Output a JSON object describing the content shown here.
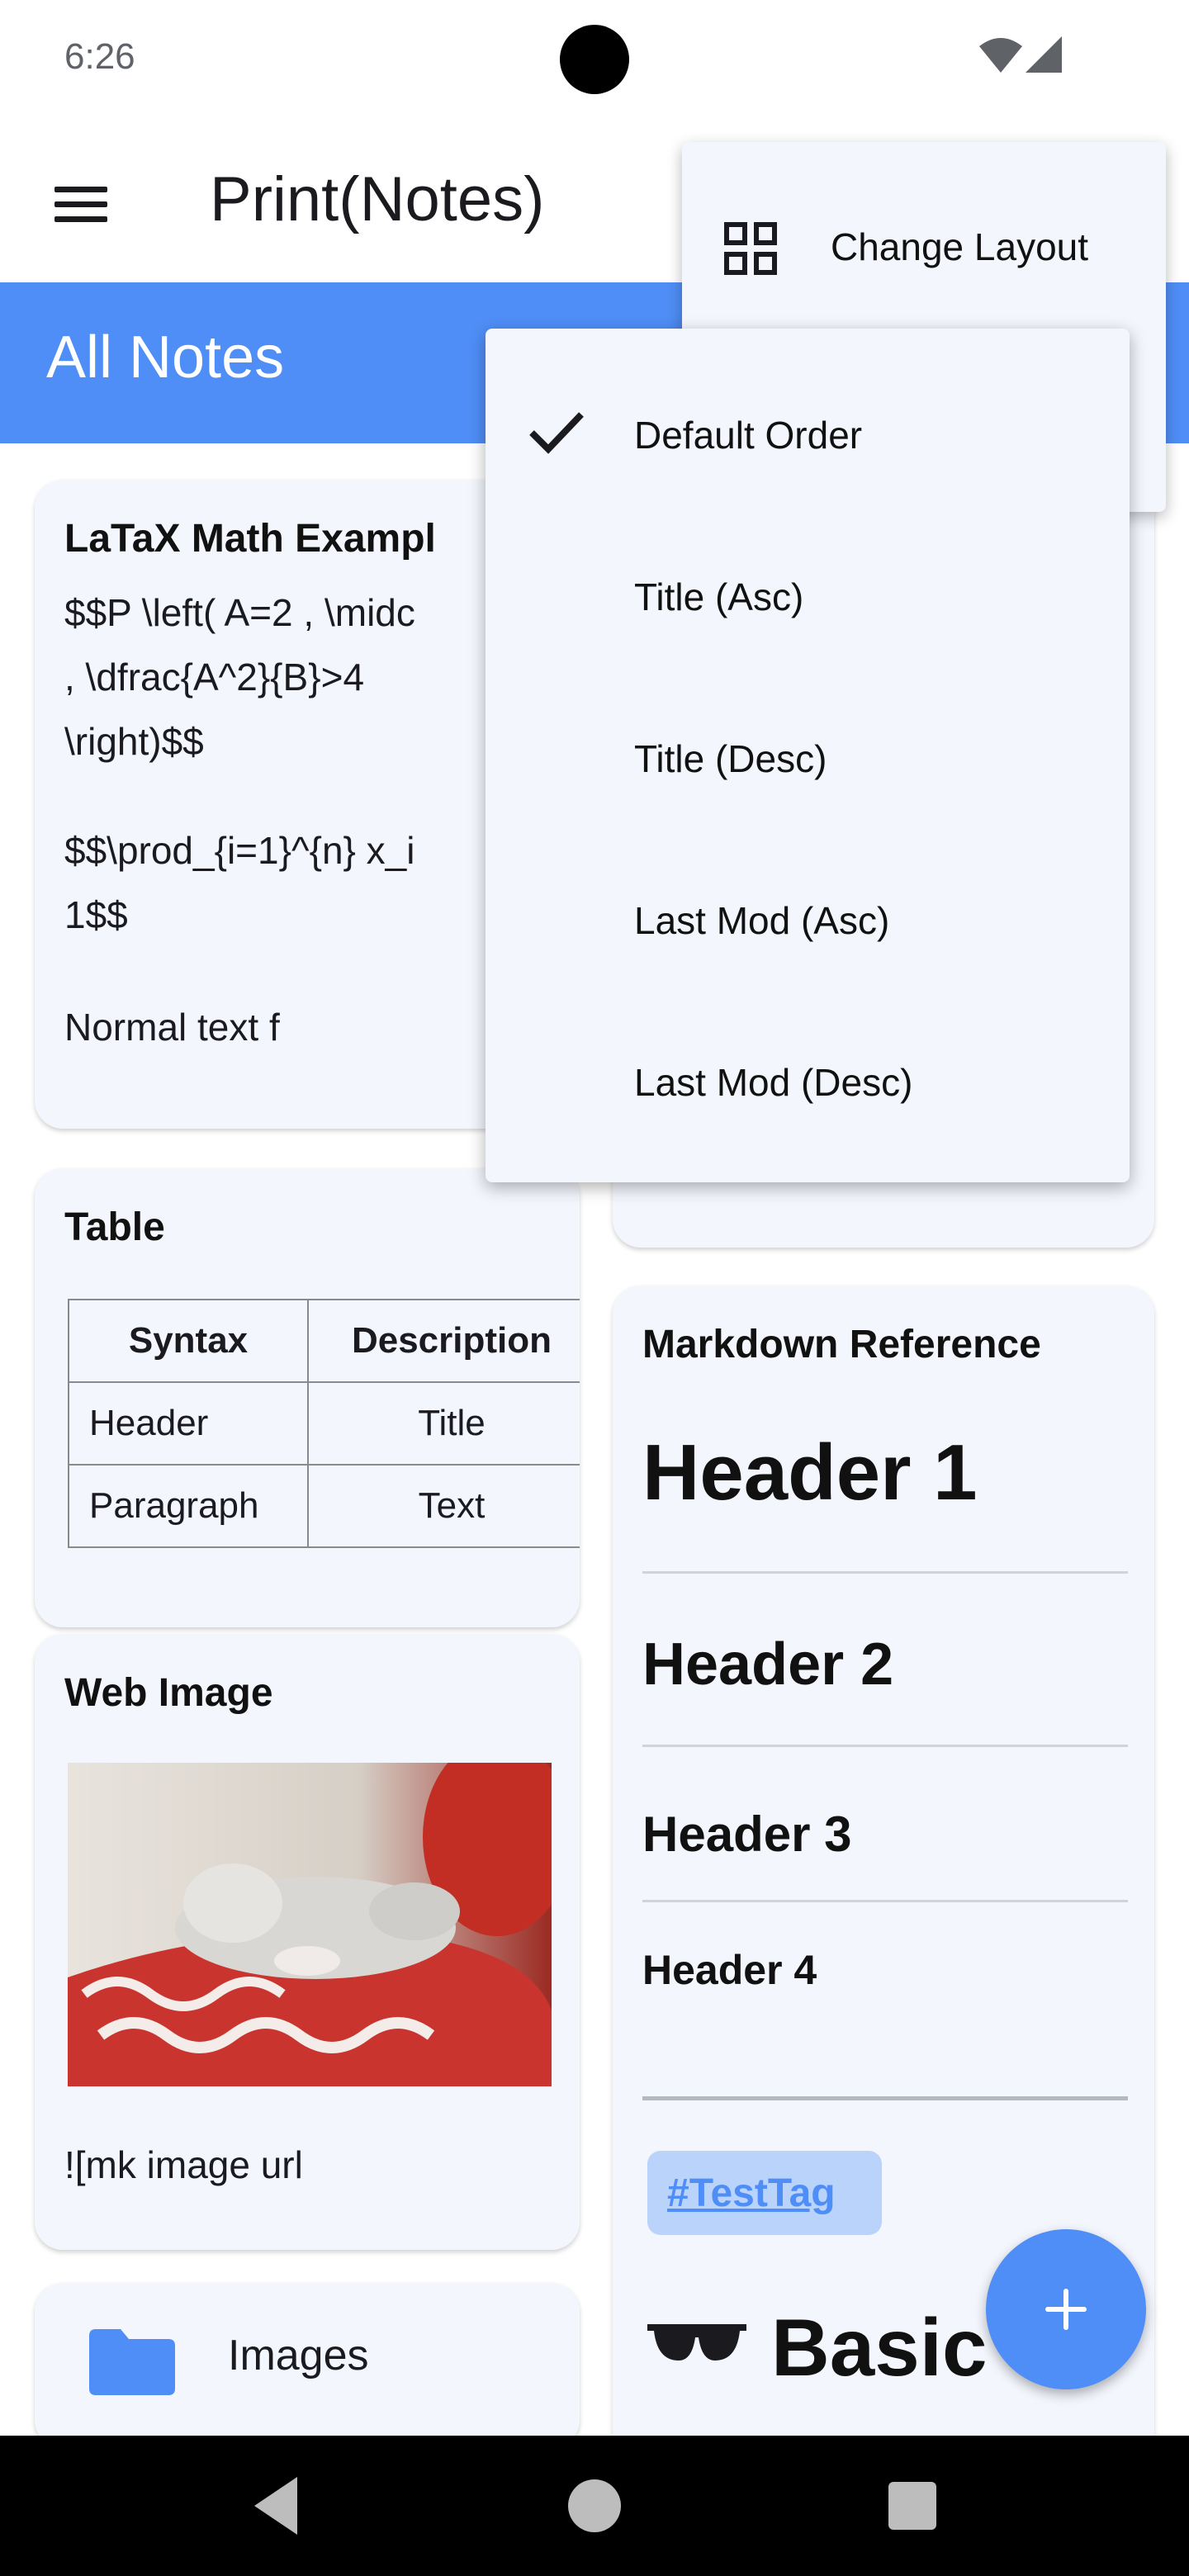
{
  "status_bar": {
    "time": "6:26"
  },
  "app_bar": {
    "title": "Print(Notes)"
  },
  "section": {
    "title": "All Notes"
  },
  "cards": {
    "latex": {
      "title": "LaTaX Math Exampl",
      "lines": [
        "$$P \\left( A=2 , \\midc",
        ", \\dfrac{A^2}{B}>4",
        "\\right)$$",
        "$$\\prod_{i=1}^{n} x_i",
        "1$$",
        "Normal text f"
      ]
    },
    "table": {
      "title": "Table",
      "headers": [
        "Syntax",
        "Description"
      ],
      "rows": [
        [
          "Header",
          "Title"
        ],
        [
          "Paragraph",
          "Text"
        ]
      ]
    },
    "web_image": {
      "title": "Web Image",
      "caption": "![mk image url"
    },
    "folder": {
      "label": "Images"
    },
    "markdown": {
      "title": "Markdown Reference",
      "h1": "Header 1",
      "h2": "Header 2",
      "h3": "Header 3",
      "h4": "Header 4",
      "tag": "#TestTag",
      "emoji_title": "Basic"
    }
  },
  "overflow_menu": {
    "change_layout": "Change Layout"
  },
  "sort_menu": {
    "selected_index": 0,
    "items": [
      "Default Order",
      "Title (Asc)",
      "Title (Desc)",
      "Last Mod (Asc)",
      "Last Mod (Desc)"
    ]
  },
  "colors": {
    "accent": "#4f8ef7",
    "card": "#f3f6fd",
    "tag_bg": "#b9d3fb"
  },
  "icons": [
    "menu-icon",
    "grid-icon",
    "check-icon",
    "folder-icon",
    "plus-icon",
    "wifi-icon",
    "signal-icon",
    "back-icon",
    "home-icon",
    "recents-icon"
  ]
}
